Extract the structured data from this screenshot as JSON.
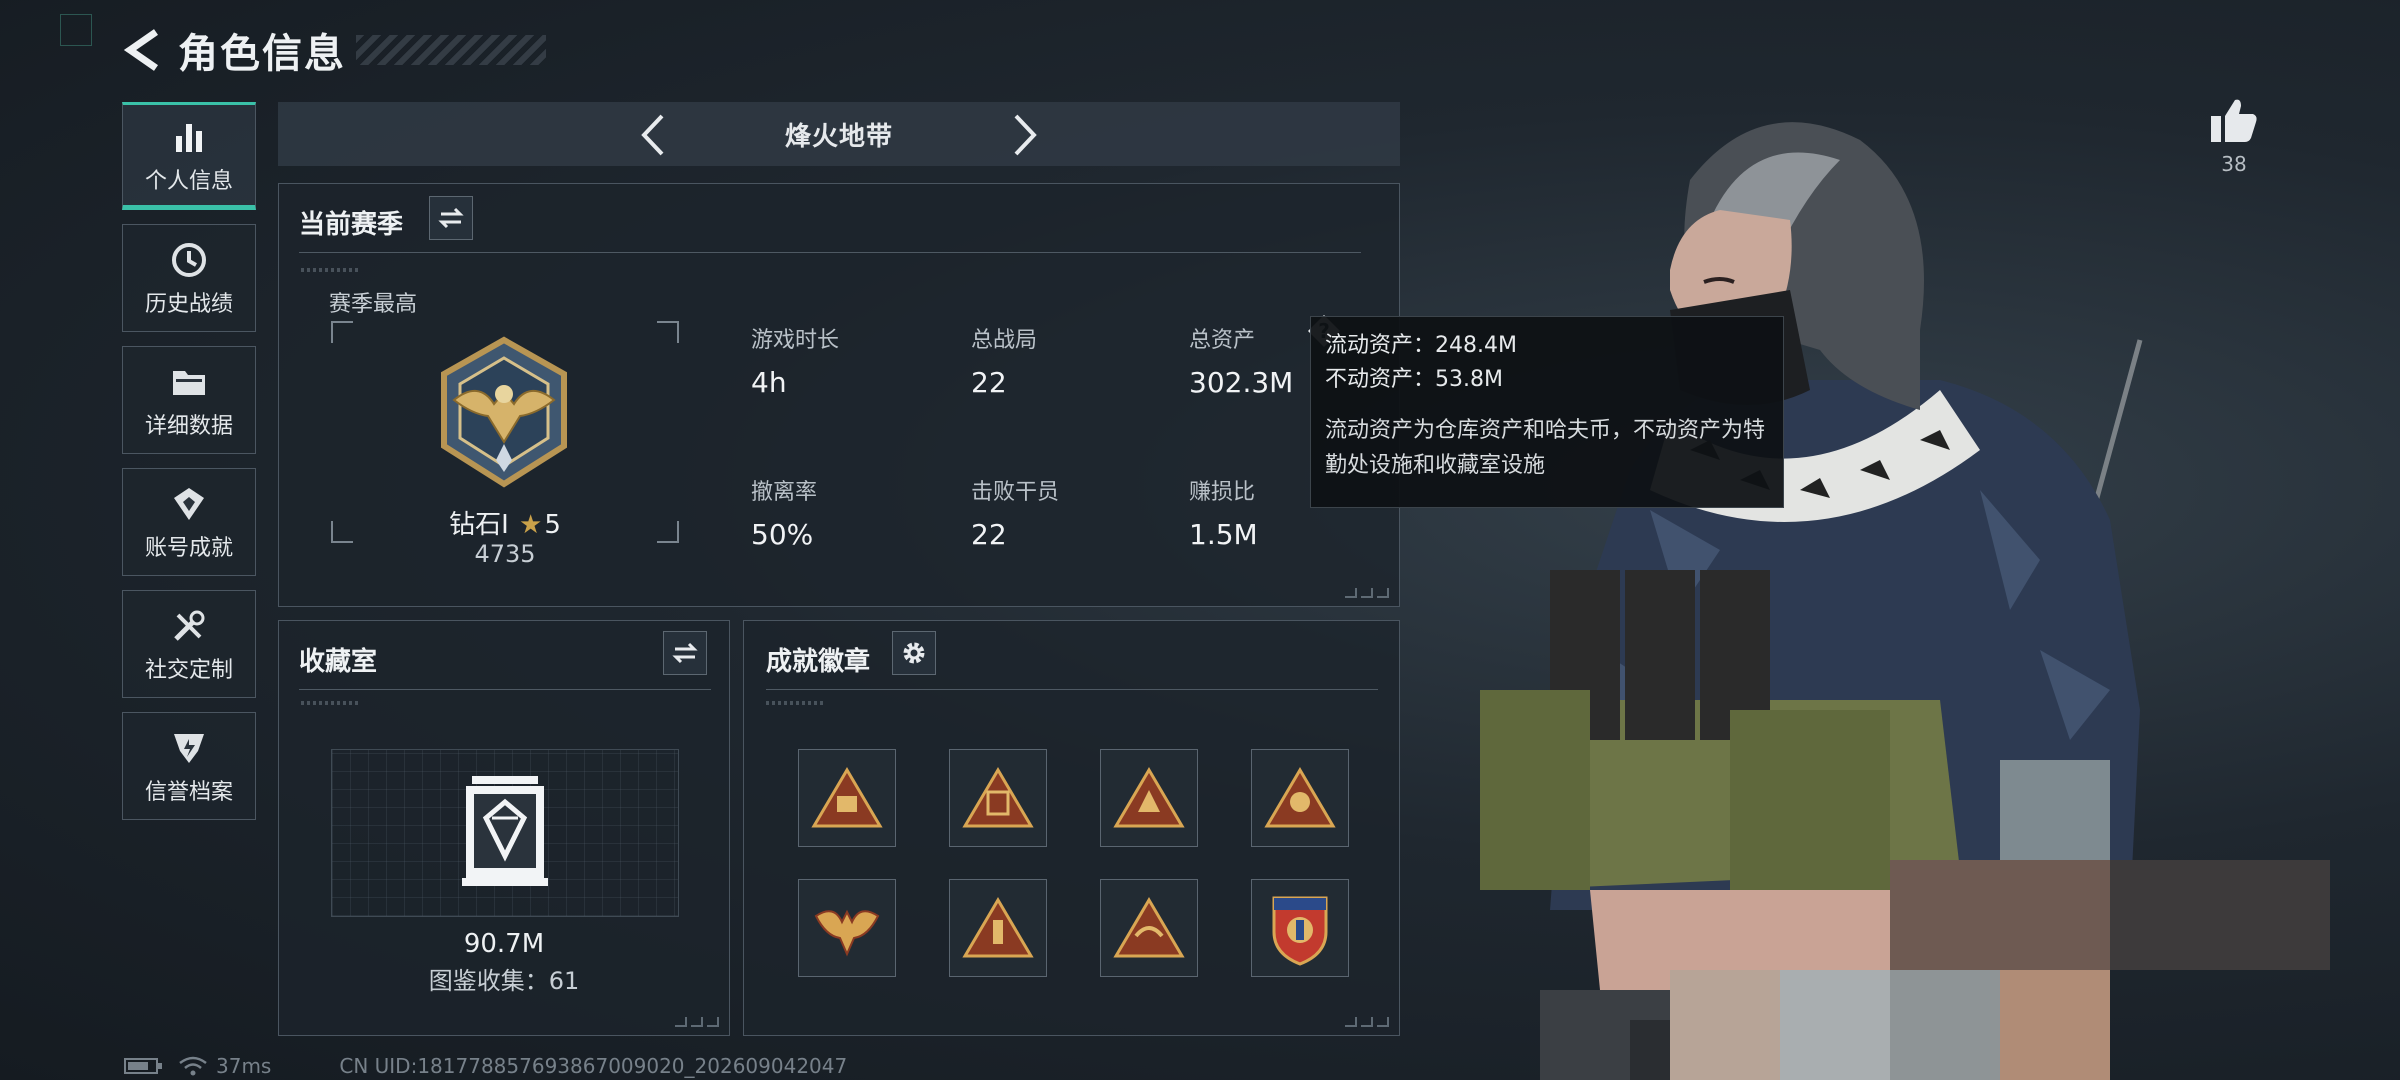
{
  "header": {
    "title": "角色信息"
  },
  "sidebar": {
    "items": [
      {
        "label": "个人信息",
        "icon": "bar-chart-icon",
        "active": true
      },
      {
        "label": "历史战绩",
        "icon": "clock-icon",
        "active": false
      },
      {
        "label": "详细数据",
        "icon": "folder-icon",
        "active": false
      },
      {
        "label": "账号成就",
        "icon": "badge-icon",
        "active": false
      },
      {
        "label": "社交定制",
        "icon": "tools-icon",
        "active": false
      },
      {
        "label": "信誉档案",
        "icon": "shield-emblem-icon",
        "active": false
      }
    ]
  },
  "season_nav": {
    "name": "烽火地带"
  },
  "current_season": {
    "title": "当前赛季",
    "best_label": "赛季最高",
    "rank_name": "钻石I",
    "rank_stars": "5",
    "rank_points": "4735",
    "stats": [
      {
        "label": "游戏时长",
        "value": "4h"
      },
      {
        "label": "总战局",
        "value": "22"
      },
      {
        "label": "总资产",
        "value": "302.3M"
      },
      {
        "label": "撤离率",
        "value": "50%"
      },
      {
        "label": "击败干员",
        "value": "22"
      },
      {
        "label": "赚损比",
        "value": "1.5M"
      }
    ]
  },
  "tooltip": {
    "liquid": "流动资产：248.4M",
    "fixed": "不动资产：53.8M",
    "note": "流动资产为仓库资产和哈夫币，不动资产为特勤处设施和收藏室设施"
  },
  "collection": {
    "title": "收藏室",
    "value": "90.7M",
    "count_text": "图鉴收集：61"
  },
  "achievements": {
    "title": "成就徽章",
    "badges": [
      "badge-1",
      "badge-2",
      "badge-3",
      "badge-4",
      "badge-5",
      "badge-6",
      "badge-7",
      "badge-8"
    ]
  },
  "likes": {
    "count": "38"
  },
  "status": {
    "ping": "37ms",
    "uid": "CN UID:181778857693867009020_202609042047"
  },
  "colors": {
    "accent": "#3ac1a8",
    "gold": "#c9a14a",
    "tooltip_bg": "#0e1114"
  }
}
